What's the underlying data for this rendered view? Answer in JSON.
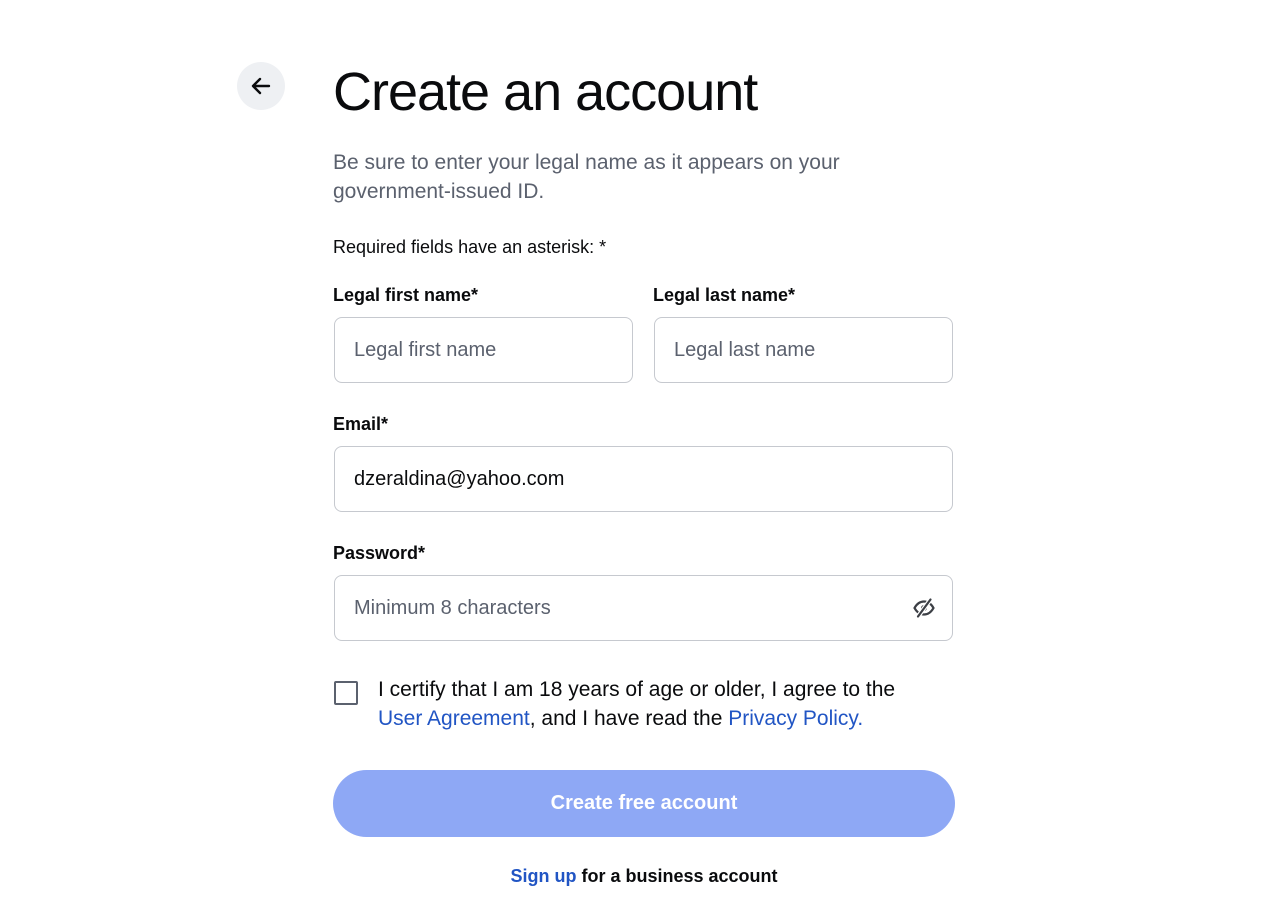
{
  "header": {
    "back_icon": "arrow-left-icon",
    "title": "Create an account",
    "subtitle": "Be sure to enter your legal name as it appears on your government-issued ID.",
    "required_note": "Required fields have an asterisk: *"
  },
  "form": {
    "first_name": {
      "label": "Legal first name*",
      "placeholder": "Legal first name",
      "value": ""
    },
    "last_name": {
      "label": "Legal last name*",
      "placeholder": "Legal last name",
      "value": ""
    },
    "email": {
      "label": "Email*",
      "placeholder": "",
      "value": "dzeraldina@yahoo.com"
    },
    "password": {
      "label": "Password*",
      "placeholder": "Minimum 8 characters",
      "value": "",
      "toggle_icon": "eye-off-icon"
    },
    "terms": {
      "checked": false,
      "text_before": "I certify that I am 18 years of age or older, I agree to the ",
      "user_agreement_link": "User Agreement",
      "text_middle": ", and I have read the ",
      "privacy_link": "Privacy Policy."
    },
    "submit_label": "Create free account"
  },
  "footer": {
    "signup_link": "Sign up",
    "signup_text": " for a business account"
  },
  "colors": {
    "link": "#2155c4",
    "button_disabled": "#8ea8f5",
    "muted_text": "#5b616e",
    "border": "#c6c9cf"
  }
}
